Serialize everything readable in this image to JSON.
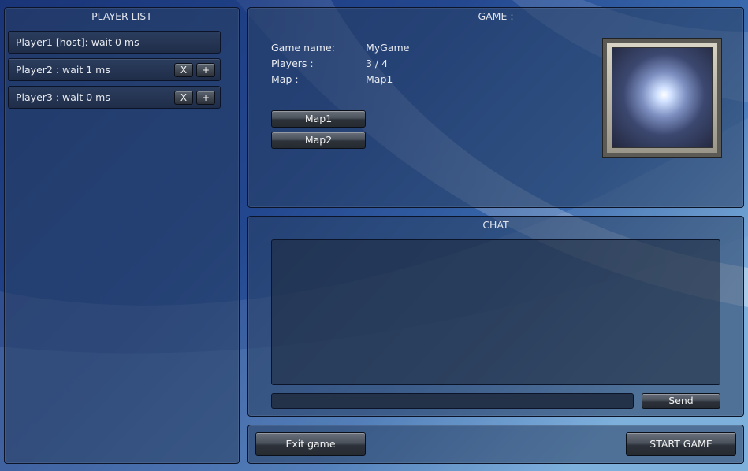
{
  "player_list": {
    "title": "PLAYER LIST",
    "players": [
      {
        "label": "Player1 [host]: wait 0 ms"
      },
      {
        "label": "Player2 : wait 1 ms",
        "kick": "X",
        "add": "+"
      },
      {
        "label": "Player3 : wait 0 ms",
        "kick": "X",
        "add": "+"
      }
    ]
  },
  "game": {
    "title": "GAME :",
    "name_label": "Game name:",
    "name_value": "MyGame",
    "players_label": "Players :",
    "players_value": "3 / 4",
    "map_label": "Map :",
    "map_value": "Map1",
    "map_buttons": [
      "Map1",
      "Map2"
    ]
  },
  "chat": {
    "title": "CHAT",
    "input_value": "",
    "send_label": "Send"
  },
  "footer": {
    "exit_label": "Exit game",
    "start_label": "START GAME"
  }
}
